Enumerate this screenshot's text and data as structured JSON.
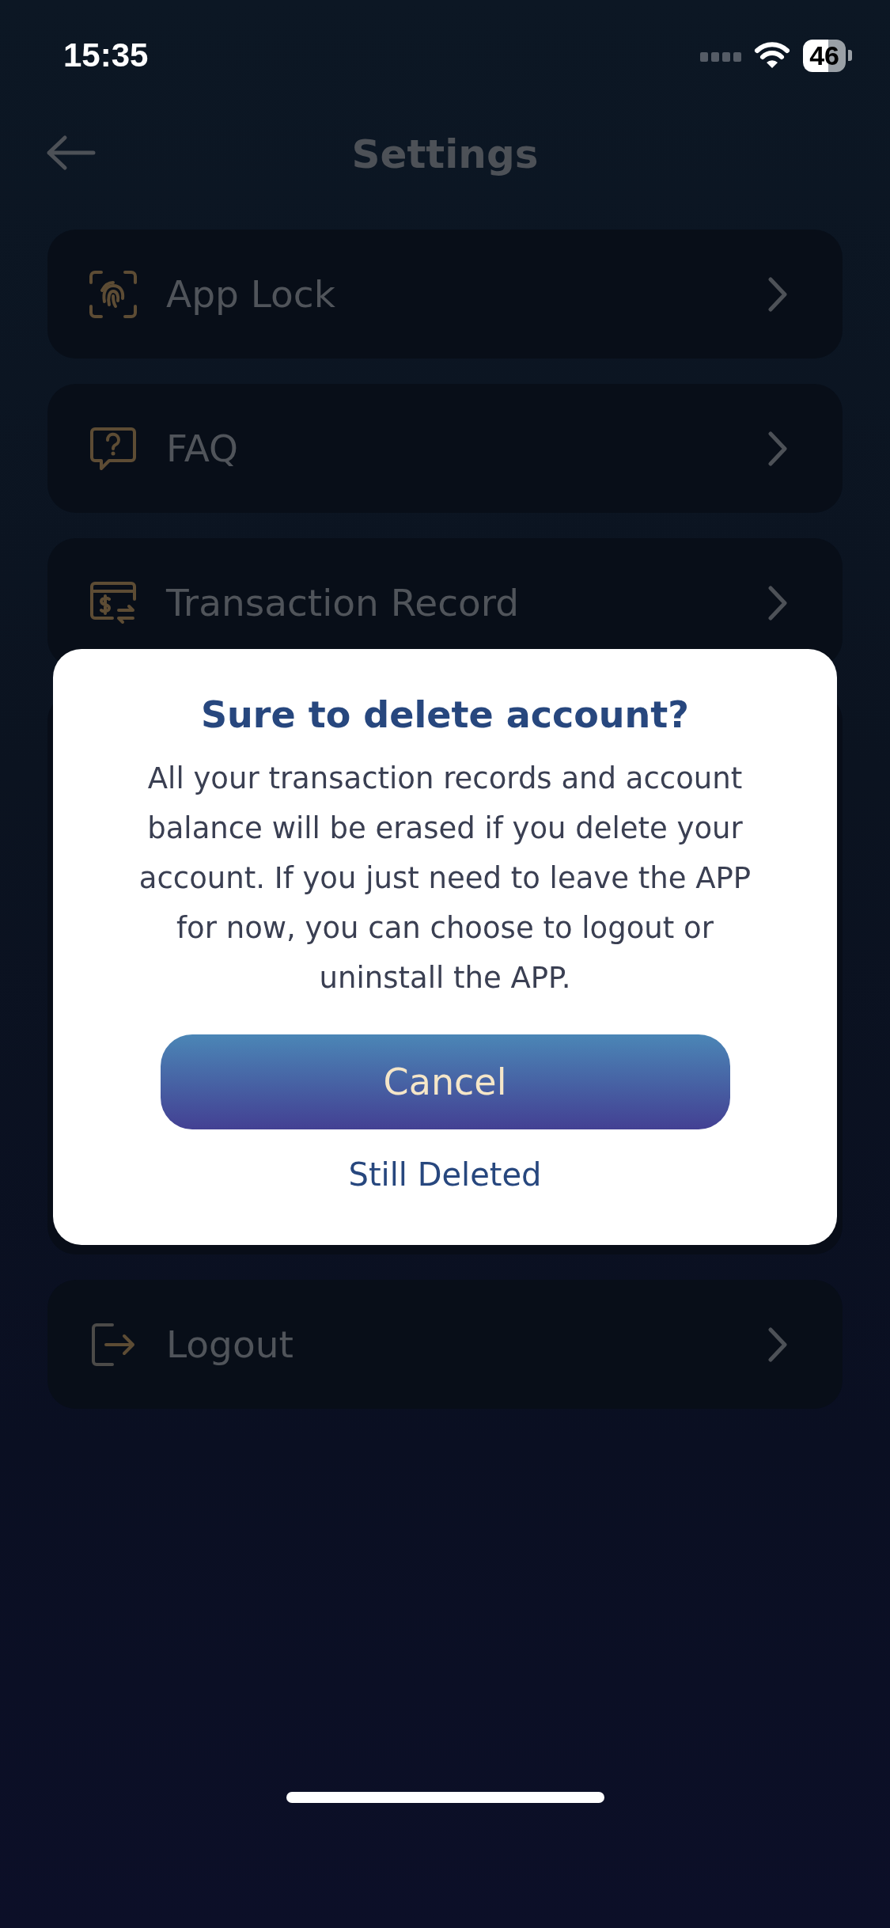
{
  "status_bar": {
    "time": "15:35",
    "battery": "46"
  },
  "header": {
    "title": "Settings"
  },
  "rows": [
    {
      "kind": "link",
      "label": "App Lock"
    },
    {
      "kind": "link",
      "label": "FAQ"
    },
    {
      "kind": "link",
      "label": "Transaction Record"
    },
    {
      "kind": "covered"
    },
    {
      "kind": "link",
      "label": "Logout"
    }
  ],
  "dialog": {
    "title": "Sure to delete account?",
    "message": "All your transaction records and account balance will be erased if you delete your account. If you just need to leave the APP for now, you can choose to logout or uninstall the APP.",
    "primary_button": "Cancel",
    "secondary_button": "Still Deleted"
  }
}
